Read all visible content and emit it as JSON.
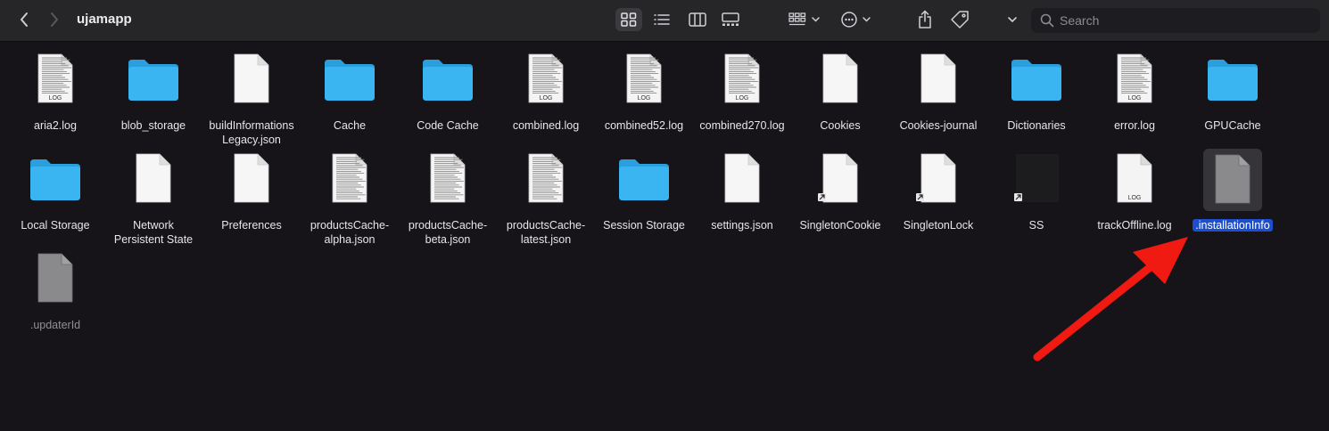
{
  "window": {
    "title": "ujamapp"
  },
  "toolbar": {
    "back_icon": "chevron-left-icon",
    "forward_icon": "chevron-right-icon",
    "view_icons": [
      "icon-view-icon",
      "list-view-icon",
      "column-view-icon",
      "gallery-view-icon"
    ],
    "group_icon": "group-by-icon",
    "more_icon": "ellipsis-circle-icon",
    "share_icon": "share-icon",
    "tag_icon": "tag-icon",
    "search_placeholder": "Search"
  },
  "files": [
    {
      "name": "aria2.log",
      "kind": "log"
    },
    {
      "name": "blob_storage",
      "kind": "folder"
    },
    {
      "name": "buildInformations\nLegacy.json",
      "kind": "doc"
    },
    {
      "name": "Cache",
      "kind": "folder"
    },
    {
      "name": "Code Cache",
      "kind": "folder"
    },
    {
      "name": "combined.log",
      "kind": "log"
    },
    {
      "name": "combined52.log",
      "kind": "log"
    },
    {
      "name": "combined270.log",
      "kind": "log"
    },
    {
      "name": "Cookies",
      "kind": "doc"
    },
    {
      "name": "Cookies-journal",
      "kind": "doc"
    },
    {
      "name": "Dictionaries",
      "kind": "folder"
    },
    {
      "name": "error.log",
      "kind": "log"
    },
    {
      "name": "GPUCache",
      "kind": "folder"
    },
    {
      "name": "Local Storage",
      "kind": "folder"
    },
    {
      "name": "Network\nPersistent State",
      "kind": "doc"
    },
    {
      "name": "Preferences",
      "kind": "doc"
    },
    {
      "name": "productsCache-\nalpha.json",
      "kind": "text"
    },
    {
      "name": "productsCache-\nbeta.json",
      "kind": "text"
    },
    {
      "name": "productsCache-\nlatest.json",
      "kind": "text"
    },
    {
      "name": "Session Storage",
      "kind": "folder"
    },
    {
      "name": "settings.json",
      "kind": "doc"
    },
    {
      "name": "SingletonCookie",
      "kind": "alias-doc"
    },
    {
      "name": "SingletonLock",
      "kind": "alias-doc"
    },
    {
      "name": "SS",
      "kind": "alias-dark"
    },
    {
      "name": "trackOffline.log",
      "kind": "log-blank"
    },
    {
      "name": ".installationInfo",
      "kind": "hidden",
      "selected": true
    },
    {
      "name": ".updaterId",
      "kind": "hidden"
    }
  ],
  "log_badge": "LOG",
  "colors": {
    "folder": "#3bb4f2",
    "selection": "#1d4ed0",
    "annotation_arrow": "#f01a12"
  }
}
